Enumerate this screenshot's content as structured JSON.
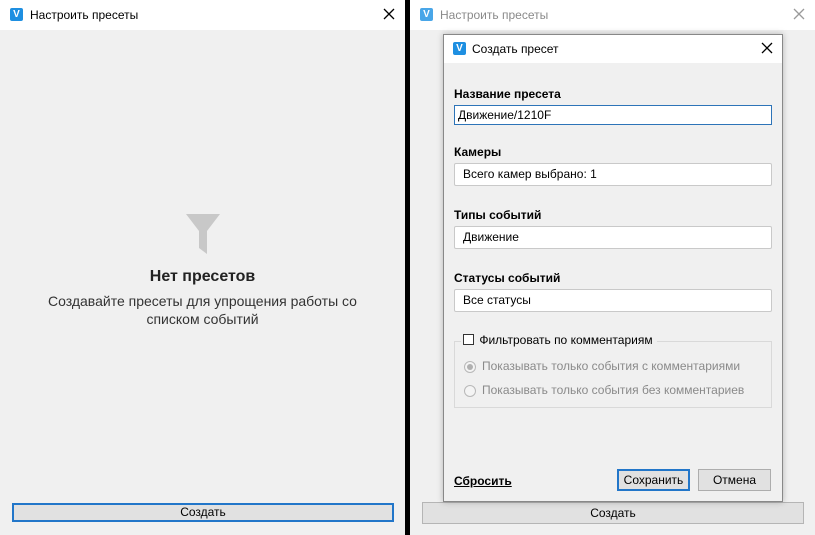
{
  "left_window": {
    "title": "Настроить пресеты",
    "empty_title": "Нет пресетов",
    "empty_desc": "Создавайте пресеты для упрощения работы со списком событий",
    "create_label": "Создать"
  },
  "right_window": {
    "title": "Настроить пресеты",
    "create_label": "Создать"
  },
  "dialog": {
    "title": "Создать пресет",
    "name_label": "Название пресета",
    "name_value": "Движение/1210F",
    "cameras_label": "Камеры",
    "cameras_value": "Всего камер выбрано: 1",
    "event_types_label": "Типы событий",
    "event_types_value": "Движение",
    "event_statuses_label": "Статусы событий",
    "event_statuses_value": "Все статусы",
    "filter_comments_label": "Фильтровать по комментариям",
    "radio_with": "Показывать только события с комментариями",
    "radio_without": "Показывать только события без комментариев",
    "reset_label": "Сбросить",
    "save_label": "Сохранить",
    "cancel_label": "Отмена"
  },
  "logo_letter": "V",
  "colors": {
    "accent": "#2276c9",
    "logo": "#1e8fe1",
    "background": "#f0f0f0"
  }
}
